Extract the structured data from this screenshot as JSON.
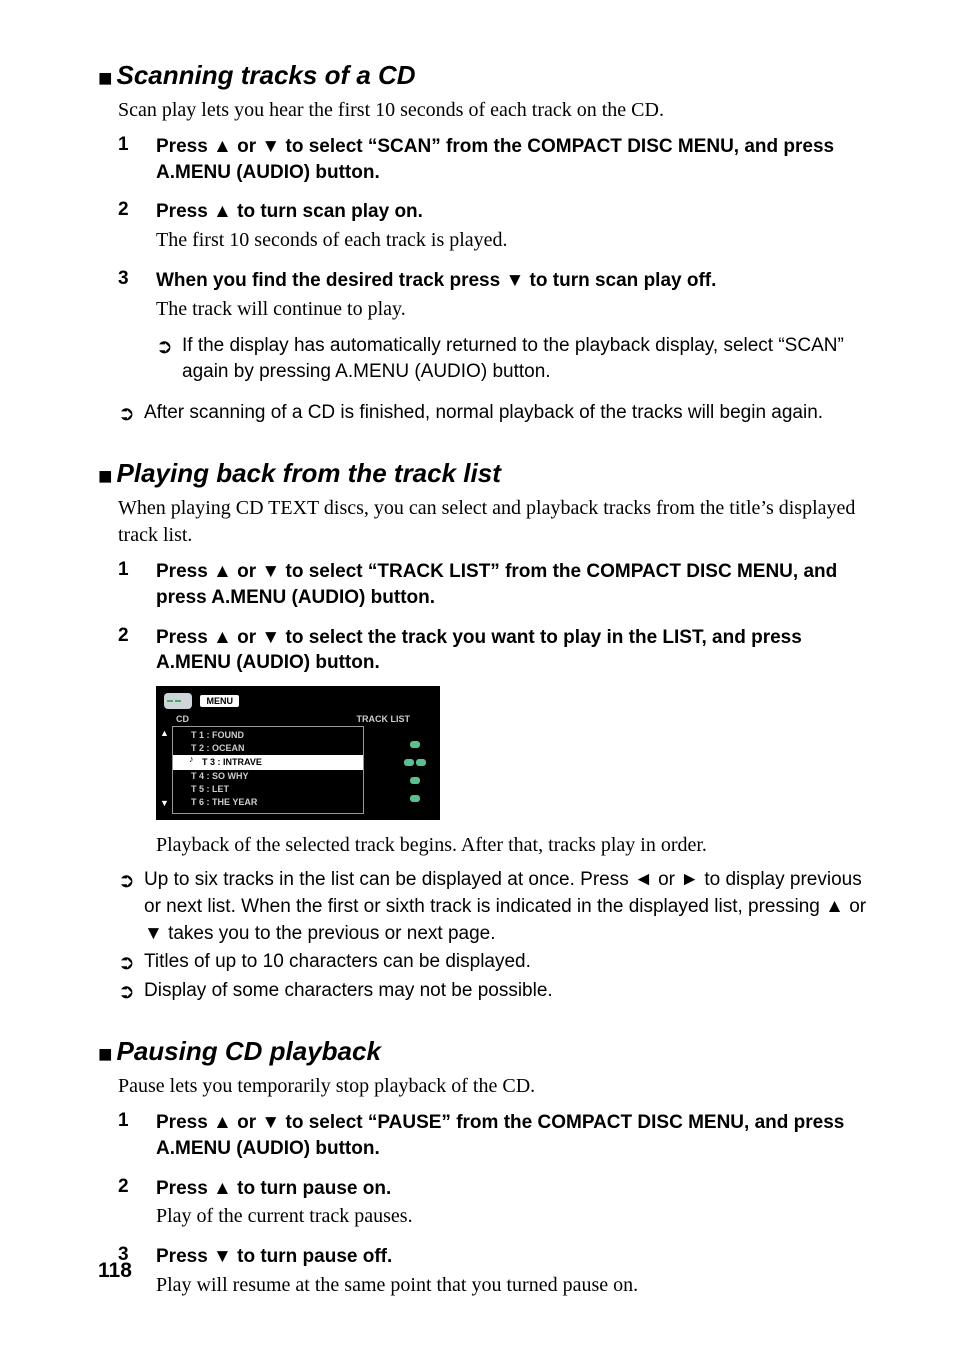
{
  "page_number": "118",
  "sections": [
    {
      "title": "Scanning tracks of a CD",
      "intro": "Scan play lets you hear the first 10 seconds of each track on the CD.",
      "steps": [
        {
          "num": "1",
          "title_pre": "Press ",
          "title_mid": " or ",
          "title_post": " to select “SCAN” from the COMPACT DISC MENU, and press A.MENU (AUDIO) button.",
          "body": ""
        },
        {
          "num": "2",
          "title_pre": "Press ",
          "title_mid": "",
          "title_post": " to turn scan play on.",
          "body": "The first 10 seconds of each track is played."
        },
        {
          "num": "3",
          "title_pre": "When you find the desired track press ",
          "title_mid": "",
          "title_post": " to turn scan play off.",
          "body": "The track will continue to play."
        }
      ],
      "inner_notes": [
        "If the display has automatically returned to the playback display, select “SCAN” again by pressing A.MENU (AUDIO) button."
      ],
      "outer_notes": [
        "After scanning of a CD is finished, normal playback of the tracks will begin again."
      ]
    },
    {
      "title": "Playing back from the track list",
      "intro": "When playing CD TEXT discs, you can select and playback tracks from the title’s displayed track list.",
      "steps": [
        {
          "num": "1",
          "title_pre": "Press ",
          "title_mid": " or ",
          "title_post": " to select “TRACK LIST” from the COMPACT DISC MENU, and press A.MENU (AUDIO) button.",
          "body": ""
        },
        {
          "num": "2",
          "title_pre": "Press ",
          "title_mid": " or ",
          "title_post": " to select the track you want to play in the LIST, and press A.MENU (AUDIO) button.",
          "body": ""
        }
      ],
      "screenshot": {
        "menu_label": "MENU",
        "left_label": "CD",
        "right_label": "TRACK LIST",
        "tracks": [
          {
            "label": "T 1 : FOUND",
            "selected": false
          },
          {
            "label": "T 2 : OCEAN",
            "selected": false
          },
          {
            "label": "T 3 : INTRAVE",
            "selected": true
          },
          {
            "label": "T 4 : SO WHY",
            "selected": false
          },
          {
            "label": "T 5 : LET",
            "selected": false
          },
          {
            "label": "T 6 : THE YEAR",
            "selected": false
          }
        ]
      },
      "caption": "Playback of the selected track begins. After that, tracks play in order.",
      "outer_notes": [
        "Up to six tracks in the list can be displayed at once. Press ◄ or ► to display previous or next list. When the first or sixth track is indicated in the displayed list, pressing ▲ or ▼ takes you to the previous or next page.",
        "Titles of up to 10 characters can be displayed.",
        "Display of some characters may not be possible."
      ]
    },
    {
      "title": "Pausing CD playback",
      "intro": "Pause lets you temporarily stop playback of the CD.",
      "steps": [
        {
          "num": "1",
          "title_pre": "Press ",
          "title_mid": " or ",
          "title_post": " to select “PAUSE” from the COMPACT DISC MENU, and press A.MENU (AUDIO) button.",
          "body": ""
        },
        {
          "num": "2",
          "title_pre": "Press ",
          "title_mid": "",
          "title_post": " to turn pause on.",
          "body": "Play of the current track pauses."
        },
        {
          "num": "3",
          "title_pre": "Press ",
          "title_mid": "",
          "title_post": " to turn pause off.",
          "body": "Play will resume at the same point that you turned pause on."
        }
      ]
    }
  ],
  "glyphs": {
    "sec_bullet": "■",
    "up": "▲",
    "down": "▼"
  }
}
